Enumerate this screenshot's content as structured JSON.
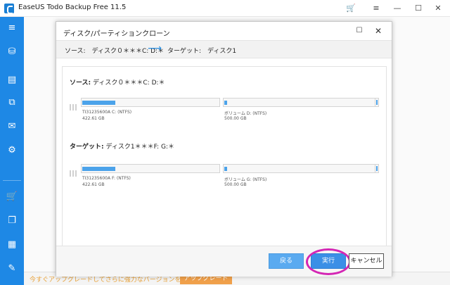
{
  "window": {
    "title": "EaseUS Todo Backup Free 11.5",
    "icons": [
      "cart-icon",
      "menu-icon",
      "minimize-icon",
      "maximize-icon",
      "close-icon"
    ],
    "accent_color": "#1e88e5"
  },
  "sidebar": {
    "items": [
      {
        "icon": "hamburger-menu-icon",
        "glyph": "≡"
      },
      {
        "icon": "disk-backup-icon",
        "glyph": "⛁"
      },
      {
        "icon": "file-backup-icon",
        "glyph": "▤"
      },
      {
        "icon": "copy-icon",
        "glyph": "⧉"
      },
      {
        "icon": "mail-backup-icon",
        "glyph": "✉"
      },
      {
        "icon": "smart-backup-icon",
        "glyph": "⚙"
      },
      {
        "icon": "cart-icon",
        "glyph": "🛒"
      },
      {
        "icon": "clone-icon",
        "glyph": "❐"
      },
      {
        "icon": "windows-tools-icon",
        "glyph": "▦"
      },
      {
        "icon": "tools-icon",
        "glyph": "✎"
      }
    ]
  },
  "banner": {
    "text": "今すぐアップグレードしてさらに強力なバージョンを体験しましょう。",
    "button_label": "アップグレード"
  },
  "dialog": {
    "title": "ディスク/パーティションクローン",
    "route": {
      "source": "ソース:　ディスク０＊＊＊C: D:＊",
      "arrow": "⟶",
      "target": "ターゲット:　ディスク1"
    },
    "source": {
      "label_prefix": "ソース:",
      "label_rest": "ディスク０＊＊＊C: D:＊",
      "partitions": [
        {
          "name": "TI31235600A C: (NTFS)",
          "size": "422.61 GB",
          "used_fraction": 0.24
        },
        {
          "name": "ボリューム D: (NTFS)",
          "size": "500.00 GB",
          "used_fraction": 0.02
        }
      ]
    },
    "target": {
      "label_prefix": "ターゲット:",
      "label_rest": "ディスク1＊＊＊F: G:＊",
      "partitions": [
        {
          "name": "TI31235600A F: (NTFS)",
          "size": "422.61 GB",
          "used_fraction": 0.24
        },
        {
          "name": "ボリューム G: (NTFS)",
          "size": "500.00 GB",
          "used_fraction": 0.02
        }
      ]
    },
    "buttons": {
      "back": "戻る",
      "run": "実行",
      "cancel": "キャンセル"
    },
    "highlight_color": "#d426b4"
  }
}
